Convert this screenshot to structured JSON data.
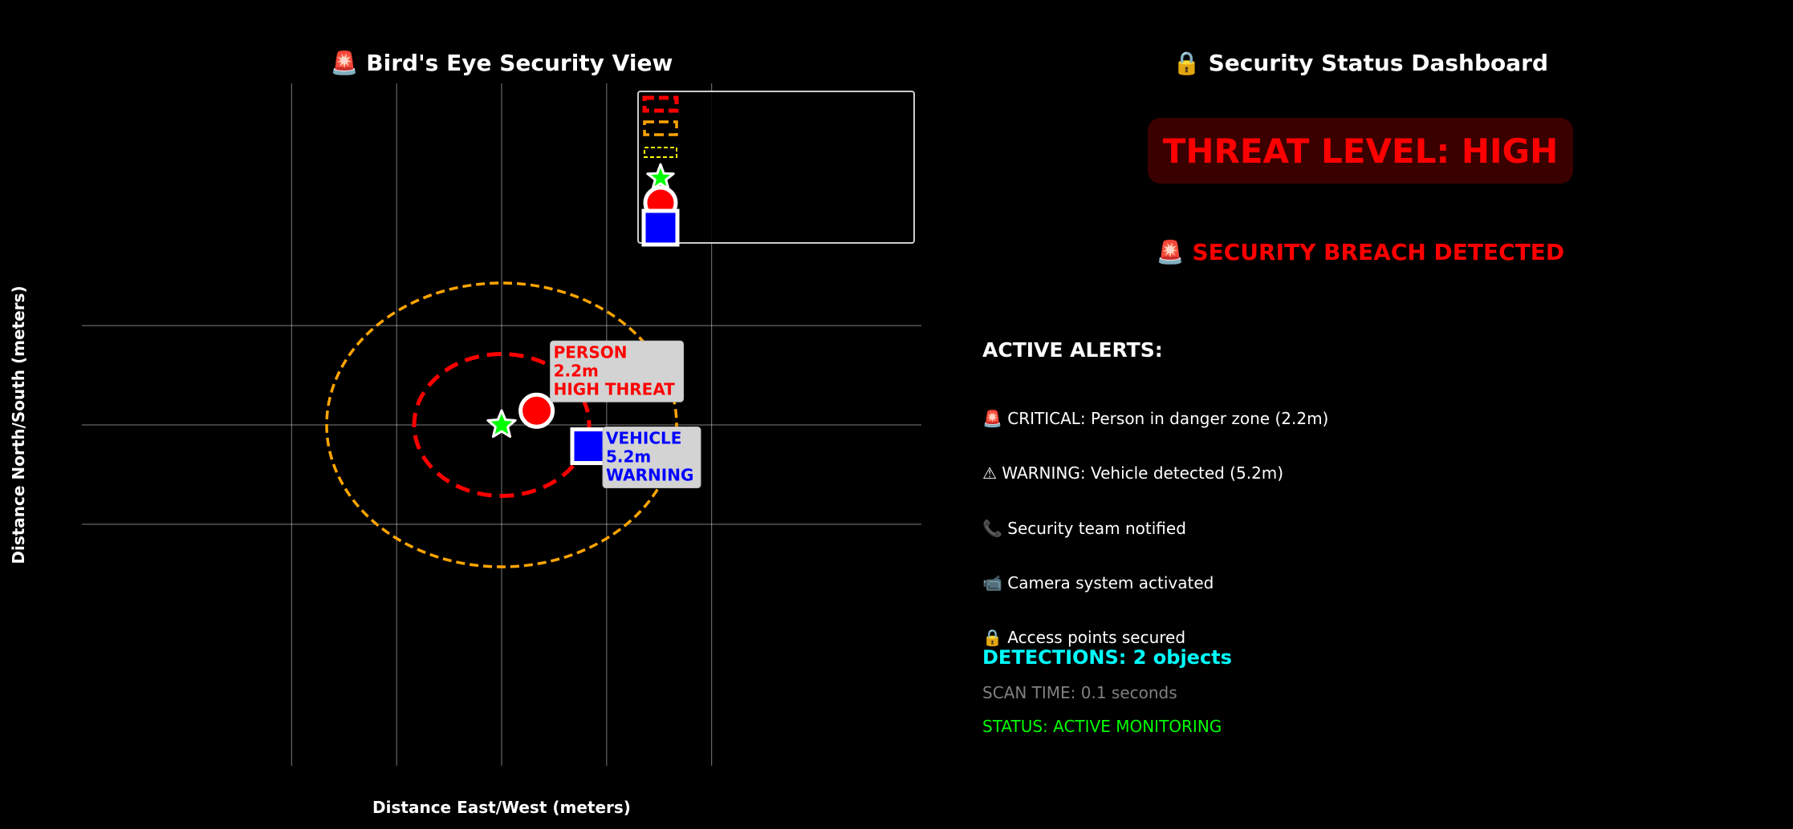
{
  "left_title": "🚨 Bird's Eye Security View",
  "right_title": "🔒 Security Status Dashboard",
  "threat_level": "THREAT LEVEL: HIGH",
  "breach_text": "🚨 SECURITY BREACH DETECTED",
  "alerts_header": "ACTIVE ALERTS:",
  "alerts": [
    "🚨 CRITICAL: Person in danger zone (2.2m)",
    "⚠ WARNING: Vehicle detected (5.2m)",
    "📞 Security team notified",
    "📹 Camera system activated",
    "🔒 Access points secured"
  ],
  "detections": "DETECTIONS: 2 objects",
  "scan_time": "SCAN TIME: 0.1 seconds",
  "status": "STATUS: ACTIVE MONITORING",
  "colors": {
    "danger": "#ff0000",
    "warning": "#ffa500",
    "caution": "#ffff00",
    "camera": "#00ff00",
    "person": "#ff0000",
    "vehicle": "#0000ff",
    "detections": "#00ffff",
    "status": "#00ff00"
  },
  "chart_data": {
    "type": "scatter",
    "title": "🚨 Bird's Eye Security View",
    "xlabel": "Distance East/West (meters)",
    "ylabel": "Distance North/South (meters)",
    "xlim": [
      -12,
      12
    ],
    "ylim": [
      -12,
      12
    ],
    "grid": true,
    "tick_labels_visible": false,
    "legend_placement": "upper right",
    "zones": [
      {
        "name": "danger",
        "radius": 5,
        "color": "#ff0000",
        "style": "dashed"
      },
      {
        "name": "warning",
        "radius": 10,
        "color": "#ffa500",
        "style": "dashed"
      }
    ],
    "camera": {
      "x": 0,
      "y": 0,
      "marker": "star",
      "color": "#00ff00"
    },
    "points": [
      {
        "type": "person",
        "x": 2,
        "y": 1,
        "marker": "circle",
        "color": "#ff0000",
        "label": "PERSON\n2.2m\nHIGH THREAT",
        "label_color": "#ff0000"
      },
      {
        "type": "vehicle",
        "x": 5,
        "y": -1.5,
        "marker": "square",
        "color": "#0000ff",
        "label": "VEHICLE\n5.2m\nWARNING",
        "label_color": "#0000ff"
      }
    ],
    "legend": [
      {
        "marker": "dashed-rect",
        "color": "#ff0000"
      },
      {
        "marker": "dashed-rect",
        "color": "#ffa500"
      },
      {
        "marker": "dashed-rect-small",
        "color": "#ffff00"
      },
      {
        "marker": "star",
        "color": "#00ff00"
      },
      {
        "marker": "circle",
        "color": "#ff0000"
      },
      {
        "marker": "square",
        "color": "#0000ff"
      }
    ]
  }
}
